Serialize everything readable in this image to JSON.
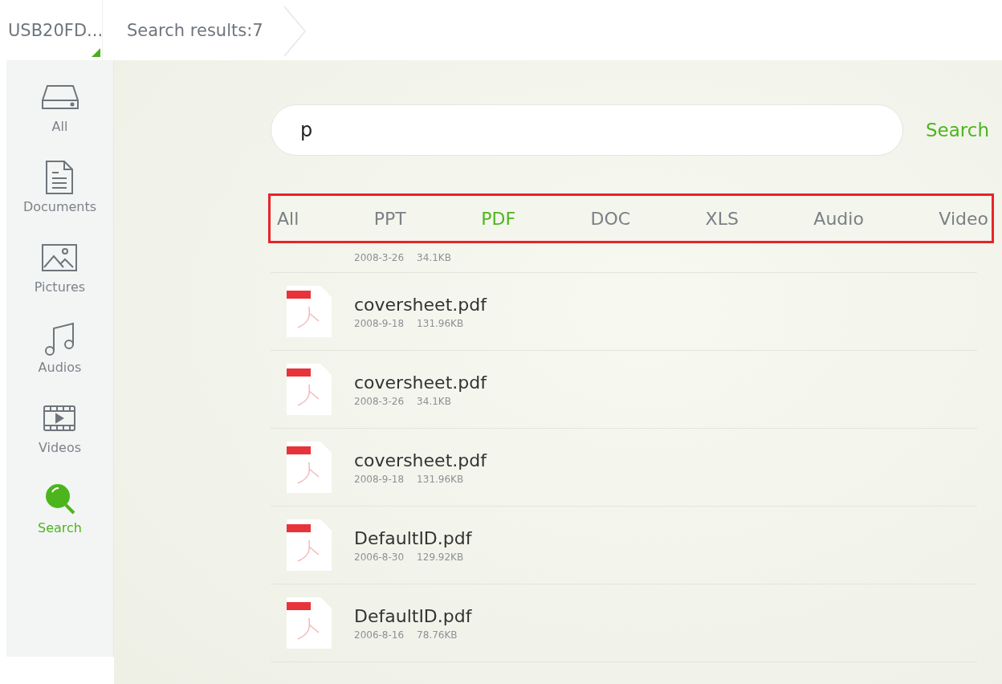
{
  "breadcrumb": [
    {
      "label": "USB20FD...",
      "kind": "root"
    },
    {
      "label": "Search results:7",
      "kind": "current"
    }
  ],
  "sidebar": {
    "items": [
      {
        "label": "All",
        "kind": "drive",
        "selected": false
      },
      {
        "label": "Documents",
        "kind": "document",
        "selected": false
      },
      {
        "label": "Pictures",
        "kind": "picture",
        "selected": false
      },
      {
        "label": "Audios",
        "kind": "music",
        "selected": false
      },
      {
        "label": "Videos",
        "kind": "video",
        "selected": false
      },
      {
        "label": "Search",
        "kind": "search",
        "selected": true
      }
    ]
  },
  "search": {
    "value": "p",
    "button": "Search"
  },
  "filters": [
    {
      "label": "All",
      "selected": false
    },
    {
      "label": "PPT",
      "selected": false
    },
    {
      "label": "PDF",
      "selected": true
    },
    {
      "label": "DOC",
      "selected": false
    },
    {
      "label": "XLS",
      "selected": false
    },
    {
      "label": "Audio",
      "selected": false
    },
    {
      "label": "Video",
      "selected": false
    }
  ],
  "files": [
    {
      "kind": "partial",
      "date": "2008-3-26",
      "size": "34.1KB"
    },
    {
      "kind": "full",
      "name": "coversheet.pdf",
      "date": "2008-9-18",
      "size": "131.96KB"
    },
    {
      "kind": "full",
      "name": "coversheet.pdf",
      "date": "2008-3-26",
      "size": "34.1KB"
    },
    {
      "kind": "full",
      "name": "coversheet.pdf",
      "date": "2008-9-18",
      "size": "131.96KB"
    },
    {
      "kind": "full",
      "name": "DefaultID.pdf",
      "date": "2006-8-30",
      "size": "129.92KB"
    },
    {
      "kind": "full",
      "name": "DefaultID.pdf",
      "date": "2006-8-16",
      "size": "78.76KB"
    }
  ]
}
